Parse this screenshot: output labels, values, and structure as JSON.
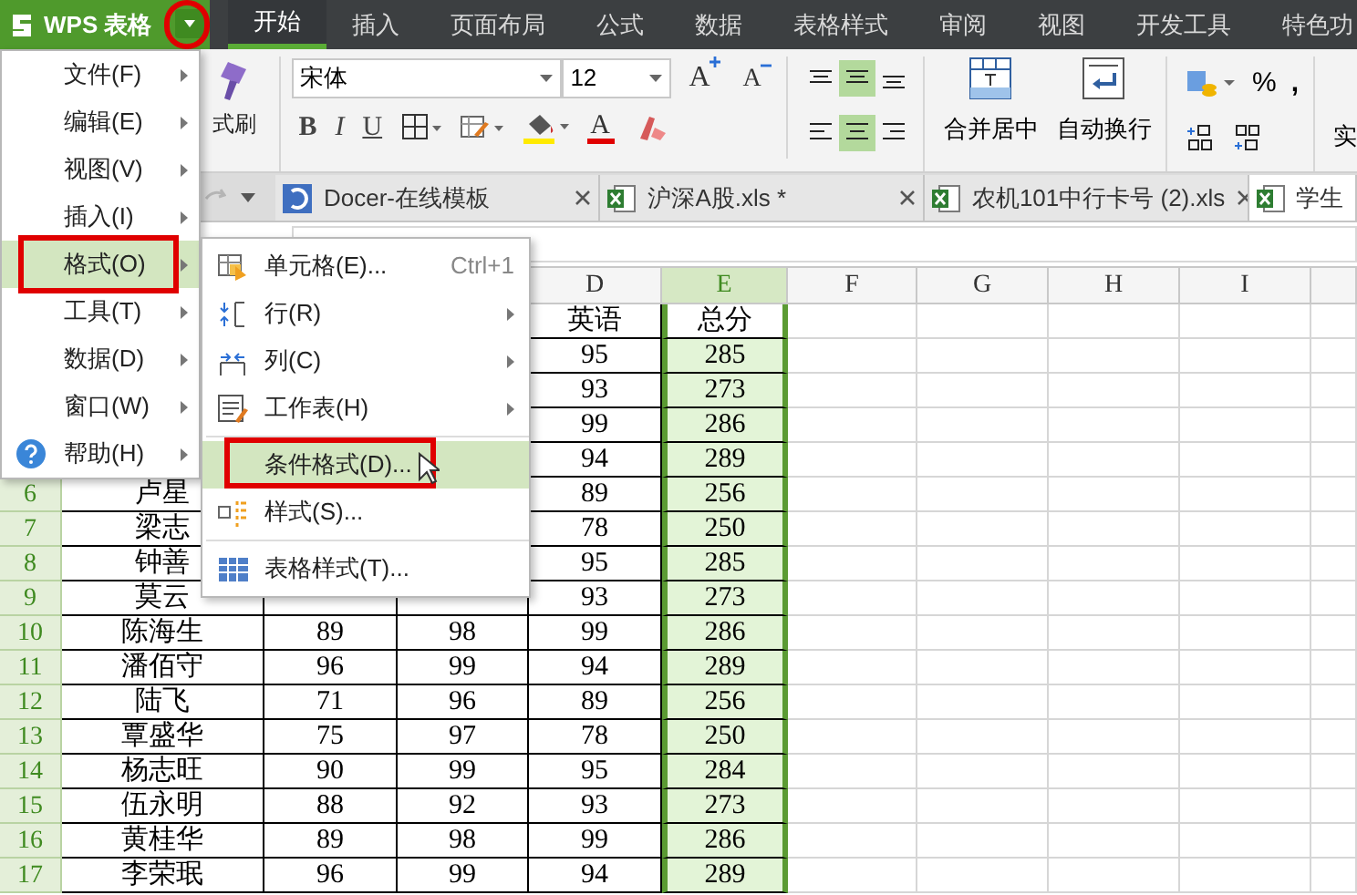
{
  "app_button": {
    "label": "WPS 表格",
    "dropdown_marked": true
  },
  "ribbon_tabs": [
    {
      "label": "开始",
      "selected": true
    },
    {
      "label": "插入",
      "selected": false
    },
    {
      "label": "页面布局",
      "selected": false
    },
    {
      "label": "公式",
      "selected": false
    },
    {
      "label": "数据",
      "selected": false
    },
    {
      "label": "表格样式",
      "selected": false
    },
    {
      "label": "审阅",
      "selected": false
    },
    {
      "label": "视图",
      "selected": false
    },
    {
      "label": "开发工具",
      "selected": false
    },
    {
      "label": "特色功",
      "selected": false
    }
  ],
  "ribbon": {
    "format_painter": "式刷",
    "font_name": "宋体",
    "font_size": "12",
    "grow_font": "A",
    "shrink_font": "A",
    "style_buttons": [
      "B",
      "I",
      "U"
    ],
    "font_color": "A",
    "align_buttons": [
      {
        "selected": false
      },
      {
        "selected": true
      },
      {
        "selected": false
      },
      {
        "selected": false
      },
      {
        "selected": true
      },
      {
        "selected": false
      }
    ],
    "merge_center": "合并居中",
    "wrap_text": "自动换行",
    "percent": "%",
    "comma": ",",
    "cut_group": "实"
  },
  "doc_tabs": [
    {
      "label": "Docer-在线模板",
      "kind": "docer",
      "selected": false
    },
    {
      "label": "沪深A股.xls *",
      "kind": "xls",
      "selected": false
    },
    {
      "label": "农机101中行卡号 (2).xls",
      "kind": "xls",
      "selected": false
    },
    {
      "label": "学生",
      "kind": "xls",
      "selected": true
    }
  ],
  "sheet": {
    "columns": [
      {
        "label": "D",
        "selected": false
      },
      {
        "label": "E",
        "selected": true
      },
      {
        "label": "F",
        "selected": false
      },
      {
        "label": "G",
        "selected": false
      },
      {
        "label": "H",
        "selected": false
      },
      {
        "label": "I",
        "selected": false
      }
    ],
    "rows": [
      {
        "d": "英语",
        "e": "总分"
      },
      {
        "d": "95",
        "e": "285"
      },
      {
        "d": "93",
        "e": "273"
      },
      {
        "d": "99",
        "e": "286"
      },
      {
        "d": "94",
        "e": "289"
      },
      {
        "number": "6",
        "a": "卢星",
        "d": "89",
        "e": "256"
      },
      {
        "number": "7",
        "a": "梁志",
        "d": "78",
        "e": "250"
      },
      {
        "number": "8",
        "a": "钟善",
        "d": "95",
        "e": "285"
      },
      {
        "number": "9",
        "a": "莫云",
        "d": "93",
        "e": "273"
      },
      {
        "number": "10",
        "a": "陈海生",
        "b": "89",
        "c": "98",
        "d": "99",
        "e": "286"
      },
      {
        "number": "11",
        "a": "潘佰守",
        "b": "96",
        "c": "99",
        "d": "94",
        "e": "289"
      },
      {
        "number": "12",
        "a": "陆飞",
        "b": "71",
        "c": "96",
        "d": "89",
        "e": "256"
      },
      {
        "number": "13",
        "a": "覃盛华",
        "b": "75",
        "c": "97",
        "d": "78",
        "e": "250"
      },
      {
        "number": "14",
        "a": "杨志旺",
        "b": "90",
        "c": "99",
        "d": "95",
        "e": "284"
      },
      {
        "number": "15",
        "a": "伍永明",
        "b": "88",
        "c": "92",
        "d": "93",
        "e": "273"
      },
      {
        "number": "16",
        "a": "黄桂华",
        "b": "89",
        "c": "98",
        "d": "99",
        "e": "286"
      },
      {
        "number": "17",
        "a": "李荣珉",
        "b": "96",
        "c": "99",
        "d": "94",
        "e": "289"
      }
    ]
  },
  "app_menu": [
    {
      "label": "文件(F)",
      "selected": false,
      "has_submenu": true
    },
    {
      "label": "编辑(E)",
      "selected": false,
      "has_submenu": true
    },
    {
      "label": "视图(V)",
      "selected": false,
      "has_submenu": true
    },
    {
      "label": "插入(I)",
      "selected": false,
      "has_submenu": true
    },
    {
      "label": "格式(O)",
      "selected": true,
      "has_submenu": true
    },
    {
      "label": "工具(T)",
      "selected": false,
      "has_submenu": true
    },
    {
      "label": "数据(D)",
      "selected": false,
      "has_submenu": true
    },
    {
      "label": "窗口(W)",
      "selected": false,
      "has_submenu": true
    },
    {
      "label": "帮助(H)",
      "selected": false,
      "has_submenu": true
    }
  ],
  "format_submenu": [
    {
      "kind": "item",
      "label": "单元格(E)...",
      "shortcut": "Ctrl+1",
      "selected": false,
      "has_submenu": false
    },
    {
      "kind": "item",
      "label": "行(R)",
      "selected": false,
      "has_submenu": true
    },
    {
      "kind": "item",
      "label": "列(C)",
      "selected": false,
      "has_submenu": true
    },
    {
      "kind": "item",
      "label": "工作表(H)",
      "selected": false,
      "has_submenu": true
    },
    {
      "kind": "separator"
    },
    {
      "kind": "item",
      "label": "条件格式(D)...",
      "selected": true,
      "has_submenu": false
    },
    {
      "kind": "item",
      "label": "样式(S)...",
      "selected": false,
      "has_submenu": false
    },
    {
      "kind": "separator"
    },
    {
      "kind": "item",
      "label": "表格样式(T)...",
      "selected": false,
      "has_submenu": false
    }
  ]
}
